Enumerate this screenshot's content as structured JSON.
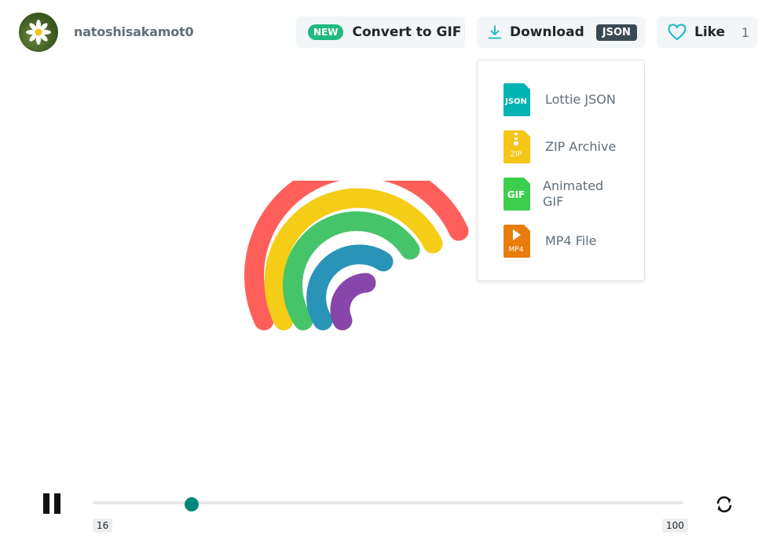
{
  "user": {
    "name": "natoshisakamot0"
  },
  "toolbar": {
    "convert": {
      "badge": "NEW",
      "label": "Convert to GIF"
    },
    "download": {
      "label": "Download",
      "format_badge": "JSON"
    },
    "like": {
      "label": "Like",
      "count": "1"
    }
  },
  "download_menu": [
    {
      "icon": "json-file-icon",
      "icon_text": "JSON",
      "label": "Lottie JSON",
      "color": "#00b4b4"
    },
    {
      "icon": "zip-file-icon",
      "icon_text": "ZIP",
      "label": "ZIP Archive",
      "color": "#f5c518"
    },
    {
      "icon": "gif-file-icon",
      "icon_text": "GIF",
      "label": "Animated GIF",
      "color": "#3ccf4e"
    },
    {
      "icon": "mp4-file-icon",
      "icon_text": "MP4",
      "label": "MP4 File",
      "color": "#e87d0d"
    }
  ],
  "player": {
    "frame_start": "16",
    "frame_end": "100",
    "progress": 0.167,
    "accent": "#00897b"
  },
  "animation": {
    "colors": [
      "#ff5f5a",
      "#f5cc16",
      "#45c46a",
      "#2a93b8",
      "#8746a9"
    ]
  }
}
